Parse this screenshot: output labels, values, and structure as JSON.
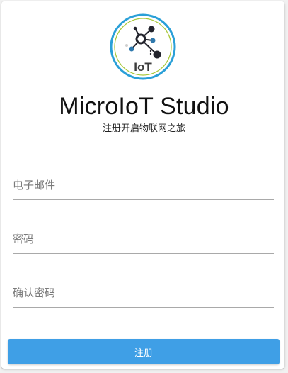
{
  "logo": {
    "text": "IoT",
    "ring_color": "#2aa0d8",
    "accent_color": "#a9c83a"
  },
  "header": {
    "title": "MicroIoT Studio",
    "subtitle": "注册开启物联网之旅"
  },
  "form": {
    "email_placeholder": "电子邮件",
    "password_placeholder": "密码",
    "confirm_placeholder": "确认密码",
    "submit_label": "注册"
  },
  "colors": {
    "button": "#3f9fe6",
    "button_text": "#ffffff"
  }
}
